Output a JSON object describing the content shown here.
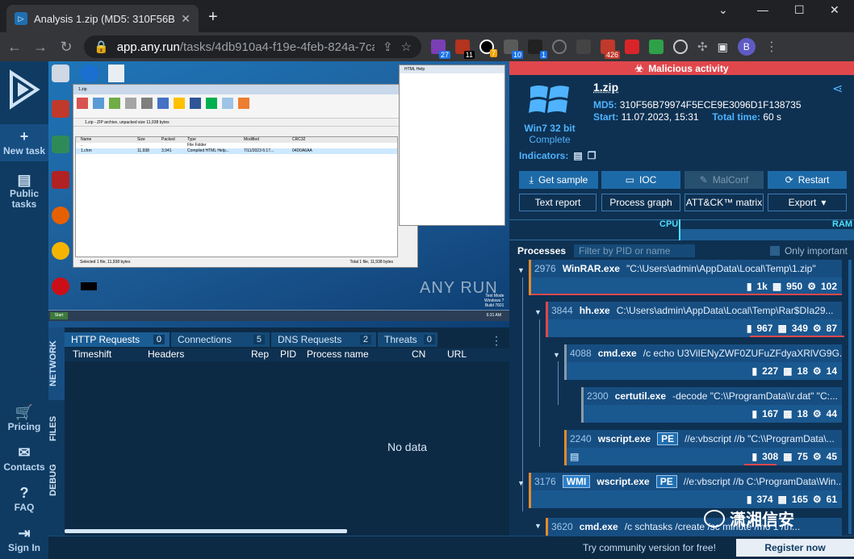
{
  "browser": {
    "tab_title": "Analysis 1.zip (MD5: 310F56B7",
    "url_host": "app.any.run",
    "url_path": "/tasks/4db910a4-f19e-4feb-824a-7ca0...",
    "ext_badges": [
      "27",
      "11",
      "7",
      "10",
      "1",
      "426"
    ],
    "avatar": "B"
  },
  "leftnav": {
    "new_task": "New task",
    "public_tasks": "Public tasks",
    "pricing": "Pricing",
    "contacts": "Contacts",
    "faq": "FAQ",
    "sign_in": "Sign In"
  },
  "vm": {
    "winrar_title": "1.zip",
    "winrar_path": "1.zip - ZIP archive, unpacked size 11,938 bytes",
    "winrar_headers": [
      "Name",
      "Size",
      "Packed",
      "Type",
      "Modified",
      "CRC32"
    ],
    "winrar_rows": [
      [
        "..",
        "",
        "",
        "File Folder",
        "",
        ""
      ],
      [
        "1.chm",
        "11,938",
        "3,941",
        "Compiled HTML Help...",
        "7/11/2023 6:17...",
        "04D0A6AA"
      ]
    ],
    "winrar_status_left": "Selected 1 file, 11,938 bytes",
    "winrar_status_right": "Total 1 file, 11,938 bytes",
    "htmlhelp_title": "HTML Help",
    "watermark": "ANY RUN",
    "win_mode": "Test Mode",
    "win_name": "Windows 7",
    "win_build": "Build 7601",
    "clock": "6:31 AM"
  },
  "network": {
    "sidetabs": [
      "NETWORK",
      "FILES",
      "DEBUG"
    ],
    "tabs": [
      {
        "label": "HTTP Requests",
        "count": "0"
      },
      {
        "label": "Connections",
        "count": "5"
      },
      {
        "label": "DNS Requests",
        "count": "2"
      },
      {
        "label": "Threats",
        "count": "0"
      }
    ],
    "columns": [
      "Timeshift",
      "Headers",
      "Rep",
      "PID",
      "Process name",
      "CN",
      "URL"
    ],
    "empty": "No data"
  },
  "footer": {
    "free_text": "Try community version for free!",
    "register": "Register now"
  },
  "task": {
    "verdict": "Malicious activity",
    "os_name": "Win7 32 bit",
    "os_status": "Complete",
    "file_name": "1.zip",
    "md5_label": "MD5:",
    "md5": "310F56B79974F5ECE9E3096D1F138735",
    "start_label": "Start:",
    "start": "11.07.2023, 15:31",
    "total_label": "Total time:",
    "total": "60 s",
    "indicators_label": "Indicators:"
  },
  "actions": {
    "get_sample": "Get sample",
    "ioc": "IOC",
    "malconf": "MalConf",
    "restart": "Restart",
    "text_report": "Text report",
    "process_graph": "Process graph",
    "attck": "ATT&CK™ matrix",
    "export": "Export"
  },
  "monitor": {
    "cpu": "CPU",
    "ram": "RAM"
  },
  "processes": {
    "tab": "Processes",
    "filter_placeholder": "Filter by PID or name",
    "only_important": "Only important",
    "items": [
      {
        "pid": "2976",
        "name": "WinRAR.exe",
        "tag": "",
        "cmd": "\"C:\\Users\\admin\\AppData\\Local\\Temp\\1.zip\"",
        "files": "1k",
        "reg": "950",
        "mods": "102"
      },
      {
        "pid": "3844",
        "name": "hh.exe",
        "tag": "",
        "cmd": "C:\\Users\\admin\\AppData\\Local\\Temp\\Rar$DIa29...",
        "files": "967",
        "reg": "349",
        "mods": "87"
      },
      {
        "pid": "4088",
        "name": "cmd.exe",
        "tag": "",
        "cmd": "/c echo U3ViIENyZWF0ZUFuZFdyaXRlVG9G...",
        "files": "227",
        "reg": "18",
        "mods": "14"
      },
      {
        "pid": "2300",
        "name": "certutil.exe",
        "tag": "",
        "cmd": "-decode \"C:\\\\ProgramData\\\\r.dat\" \"C:...",
        "files": "167",
        "reg": "18",
        "mods": "44"
      },
      {
        "pid": "2240",
        "name": "wscript.exe",
        "tag": "PE",
        "cmd": "//e:vbscript //b \"C:\\\\ProgramData\\...",
        "files": "308",
        "reg": "75",
        "mods": "45"
      },
      {
        "pid": "3176",
        "name": "wscript.exe",
        "tag": "PE",
        "wmi": "WMI",
        "cmd": "//e:vbscript //b C:\\ProgramData\\Win...",
        "files": "374",
        "reg": "165",
        "mods": "61"
      },
      {
        "pid": "3620",
        "name": "cmd.exe",
        "tag": "",
        "cmd": "/c schtasks /create /sc minute /mo 1 /tn...",
        "files": "",
        "reg": "",
        "mods": ""
      }
    ]
  },
  "watermark_text": "潇湘信安",
  "colors": {
    "accent": "#1d6aa8",
    "danger": "#e0474c",
    "bg": "#0e3152"
  }
}
